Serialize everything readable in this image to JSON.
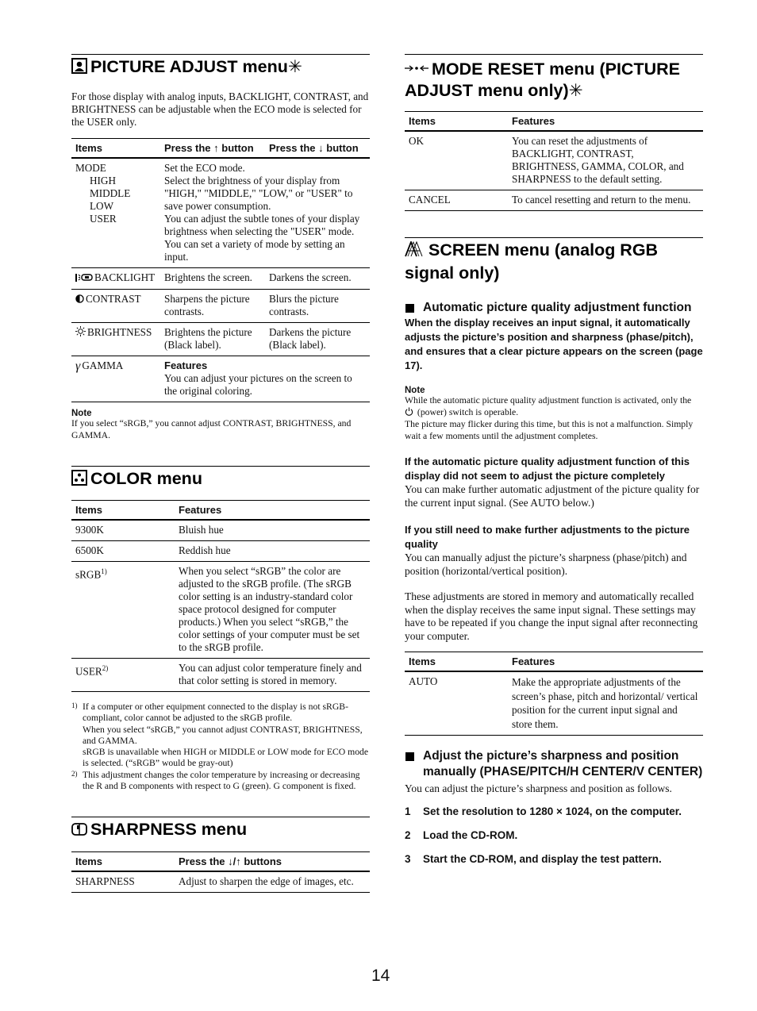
{
  "page_number": "14",
  "picture_adjust": {
    "title": "PICTURE ADJUST menu",
    "star": "✳",
    "icon": "picture-adjust-icon",
    "intro": "For those display with analog inputs, BACKLIGHT, CONTRAST, and BRIGHTNESS can be adjustable when the ECO mode is selected for the USER only.",
    "headers": {
      "items": "Items",
      "up": "Press the ↑ button",
      "down": "Press the ↓ button"
    },
    "mode": {
      "label": "MODE",
      "subitems": [
        "HIGH",
        "MIDDLE",
        "LOW",
        "USER"
      ],
      "description": "Set the ECO mode.\nSelect the brightness of your display from \"HIGH,\" \"MIDDLE,\" \"LOW,\" or \"USER\" to save power consumption.\nYou can adjust the subtle tones of your display brightness when selecting the \"USER\" mode.\nYou can set a variety of mode by setting an input."
    },
    "rows": [
      {
        "icon": "backlight-icon",
        "label": "BACKLIGHT",
        "up": "Brightens the screen.",
        "down": "Darkens the screen."
      },
      {
        "icon": "contrast-icon",
        "label": "CONTRAST",
        "up": "Sharpens the picture contrasts.",
        "down": "Blurs the picture contrasts."
      },
      {
        "icon": "brightness-icon",
        "label": "BRIGHTNESS",
        "up": "Brightens the picture (Black label).",
        "down": "Darkens the picture (Black label)."
      }
    ],
    "gamma": {
      "icon": "gamma-icon",
      "label": "GAMMA",
      "features_label": "Features",
      "description": "You can adjust your pictures on the screen to the original coloring."
    },
    "note_heading": "Note",
    "note": "If you select “sRGB,” you cannot adjust CONTRAST, BRIGHTNESS, and GAMMA."
  },
  "color": {
    "title": "COLOR menu",
    "icon": "color-icon",
    "headers": {
      "items": "Items",
      "features": "Features"
    },
    "rows": [
      {
        "label": "9300K",
        "sup": "",
        "feature": "Bluish hue"
      },
      {
        "label": "6500K",
        "sup": "",
        "feature": "Reddish hue"
      },
      {
        "label": "sRGB",
        "sup": "1)",
        "feature": "When you select “sRGB” the color are adjusted to the sRGB profile. (The sRGB color setting is an industry-standard color space protocol designed for computer products.) When you select “sRGB,” the color settings of your computer must be set to the sRGB profile."
      },
      {
        "label": "USER",
        "sup": "2)",
        "feature": "You can adjust color temperature finely and that color setting is stored in memory."
      }
    ],
    "footnotes": [
      {
        "mark": "1)",
        "text": "If a computer or other equipment connected to the display is not sRGB-compliant, color cannot be adjusted to the sRGB profile.\nWhen you select “sRGB,” you cannot adjust CONTRAST, BRIGHTNESS, and GAMMA.\nsRGB is unavailable when HIGH or MIDDLE or LOW mode for ECO mode is selected. (“sRGB” would be gray-out)"
      },
      {
        "mark": "2)",
        "text": "This adjustment changes the color temperature by increasing or decreasing the R and B components with respect to G (green). G component is fixed."
      }
    ]
  },
  "sharpness": {
    "title": "SHARPNESS menu",
    "icon": "sharpness-icon",
    "headers": {
      "items": "Items",
      "buttons": "Press the ↓/↑ buttons"
    },
    "rows": [
      {
        "label": "SHARPNESS",
        "feature": "Adjust to sharpen the edge of images, etc."
      }
    ]
  },
  "mode_reset": {
    "title": "MODE RESET menu (PICTURE ADJUST menu only)",
    "star": "✳",
    "icon": "mode-reset-icon",
    "headers": {
      "items": "Items",
      "features": "Features"
    },
    "rows": [
      {
        "label": "OK",
        "feature": "You can reset the adjustments of BACKLIGHT, CONTRAST, BRIGHTNESS, GAMMA, COLOR, and SHARPNESS to the default setting."
      },
      {
        "label": "CANCEL",
        "feature": "To cancel resetting and return to the menu."
      }
    ]
  },
  "screen": {
    "title": "SCREEN menu (analog RGB signal only)",
    "icon": "screen-icon",
    "auto_heading": "Automatic picture quality adjustment function",
    "auto_bold": "When the display receives an input signal, it automatically adjusts the picture’s position and sharpness (phase/pitch), and ensures that a clear picture appears on the screen (page 17).",
    "note_heading": "Note",
    "note_line1_a": "While the automatic picture quality adjustment function is activated, only the",
    "note_line1_b": "(power) switch is operable.",
    "note_line2": "The picture may flicker during this time, but this is not a malfunction. Simply wait a few moments until the adjustment completes.",
    "further_heading": "If the automatic picture quality adjustment function of this display did not seem to adjust the picture completely",
    "further_text": "You can make further automatic adjustment of the picture quality for the current input signal. (See AUTO below.)",
    "manual_heading": "If you still need to make further adjustments to the picture quality",
    "manual_text": "You can manually adjust the picture’s sharpness (phase/pitch) and position (horizontal/vertical position).",
    "stored_text": "These adjustments are stored in memory and automatically recalled when the display receives the same input signal. These settings may have to be repeated if you change the input signal after reconnecting your computer.",
    "headers": {
      "items": "Items",
      "features": "Features"
    },
    "rows": [
      {
        "label": "AUTO",
        "feature": "Make the appropriate adjustments of the screen’s phase, pitch and horizontal/ vertical position for the current input signal and store them."
      }
    ],
    "adjust_heading": "Adjust the picture’s sharpness and position manually (PHASE/PITCH/H CENTER/V CENTER)",
    "adjust_text": "You can adjust the picture’s sharpness and position as follows.",
    "steps": [
      {
        "num": "1",
        "text": "Set the resolution to 1280 × 1024, on the computer."
      },
      {
        "num": "2",
        "text": "Load the CD-ROM."
      },
      {
        "num": "3",
        "text": "Start the CD-ROM, and display the test pattern."
      }
    ]
  }
}
